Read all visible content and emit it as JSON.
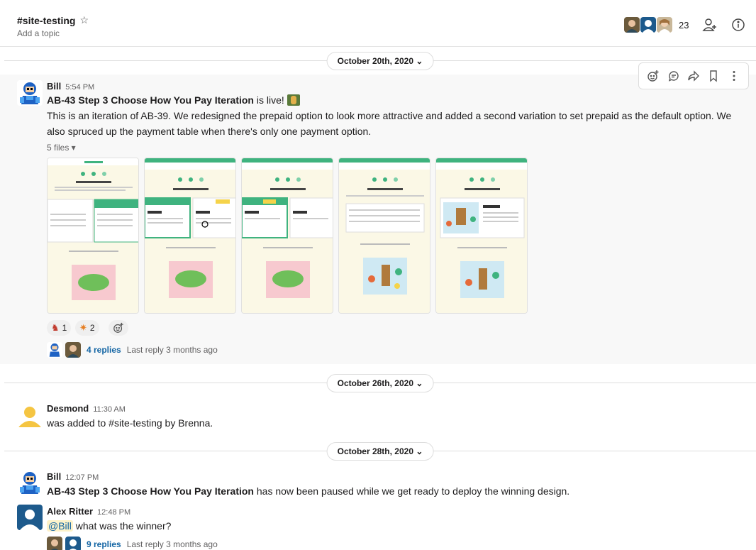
{
  "header": {
    "channel_name": "#site-testing",
    "topic_placeholder": "Add a topic",
    "member_count": "23"
  },
  "dates": {
    "d1": "October 20th, 2020 ⌄",
    "d2": "October 26th, 2020 ⌄",
    "d3": "October 28th, 2020 ⌄"
  },
  "messages": {
    "m1": {
      "author": "Bill",
      "time": "5:54 PM",
      "line1_bold": "AB-43 Step 3 Choose How You Pay Iteration",
      "line1_rest": " is live!",
      "body": "This is an iteration of AB-39. We redesigned the prepaid option to look more attractive and added a second variation to set prepaid as the default option. We also spruced up the payment table when there's only one payment option.",
      "files_label": "5 files ▾",
      "reactions": [
        {
          "count": "1"
        },
        {
          "count": "2"
        }
      ],
      "replies": "4 replies",
      "last_reply": "Last reply 3 months ago"
    },
    "m2": {
      "author": "Desmond",
      "time": "11:30 AM",
      "body": "was added to #site-testing by Brenna."
    },
    "m3": {
      "author": "Bill",
      "time": "12:07 PM",
      "body_bold": "AB-43 Step 3 Choose How You Pay Iteration",
      "body_rest": " has now been paused while we get ready to deploy the winning design."
    },
    "m4": {
      "author": "Alex Ritter",
      "time": "12:48 PM",
      "mention": "@Bill",
      "body_rest": " what was the winner?",
      "replies": "9 replies",
      "last_reply": "Last reply 3 months ago"
    }
  },
  "colors": {
    "accent_green": "#3fb37f",
    "link_blue": "#1264a3",
    "thumb_bg": "#fbf8e6"
  }
}
